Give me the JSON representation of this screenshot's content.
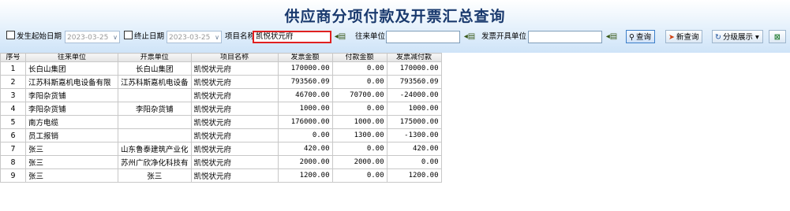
{
  "page": {
    "title": "供应商分项付款及开票汇总查询"
  },
  "toolbar": {
    "start_date_label": "发生起始日期",
    "start_date_value": "2023-03-25",
    "end_date_label": "终止日期",
    "end_date_value": "2023-03-25",
    "project_label": "项目名称",
    "project_value": "凯悦状元府",
    "partner_label": "往来单位",
    "partner_value": "",
    "invoice_unit_label": "发票开具单位",
    "invoice_unit_value": "",
    "query_label": "查询",
    "new_query_label": "新查询",
    "group_label": "分级展示"
  },
  "table": {
    "columns": [
      "序号",
      "往来单位",
      "开票单位",
      "项目名称",
      "发票金额",
      "付款金额",
      "发票减付款"
    ],
    "rows": [
      [
        "1",
        "长白山集团",
        "长白山集团",
        "凯悦状元府",
        "170000.00",
        "0.00",
        "170000.00"
      ],
      [
        "2",
        "江苏科斯嘉机电设备有限",
        "江苏科斯嘉机电设备",
        "凯悦状元府",
        "793560.09",
        "0.00",
        "793560.09"
      ],
      [
        "3",
        "李阳杂货铺",
        "",
        "凯悦状元府",
        "46700.00",
        "70700.00",
        "-24000.00"
      ],
      [
        "4",
        "李阳杂货铺",
        "李阳杂货铺",
        "凯悦状元府",
        "1000.00",
        "0.00",
        "1000.00"
      ],
      [
        "5",
        "南方电缆",
        "",
        "凯悦状元府",
        "176000.00",
        "1000.00",
        "175000.00"
      ],
      [
        "6",
        "员工报销",
        "",
        "凯悦状元府",
        "0.00",
        "1300.00",
        "-1300.00"
      ],
      [
        "7",
        "张三",
        "山东鲁泰建筑产业化",
        "凯悦状元府",
        "420.00",
        "0.00",
        "420.00"
      ],
      [
        "8",
        "张三",
        "苏州广欣净化科技有",
        "凯悦状元府",
        "2000.00",
        "2000.00",
        "0.00"
      ],
      [
        "9",
        "张三",
        "张三",
        "凯悦状元府",
        "1200.00",
        "0.00",
        "1200.00"
      ]
    ]
  }
}
